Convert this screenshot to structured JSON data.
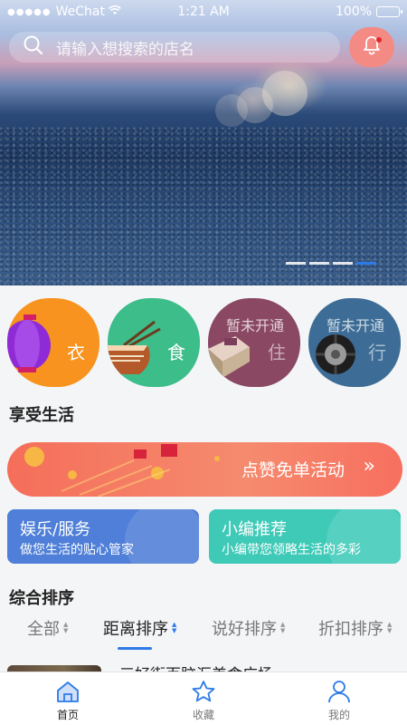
{
  "status_bar": {
    "carrier": "WeChat",
    "time": "1:21 AM",
    "battery": "100%"
  },
  "search": {
    "placeholder": "请输入想搜索的店名"
  },
  "carousel": {
    "page_count": 4,
    "active_index": 3
  },
  "categories": [
    {
      "label": "衣",
      "note": "",
      "color": "#f7931e",
      "enabled": true
    },
    {
      "label": "食",
      "note": "",
      "color": "#3dbd8a",
      "enabled": true
    },
    {
      "label": "住",
      "note": "暂未开通",
      "color": "#8a4862",
      "enabled": false
    },
    {
      "label": "行",
      "note": "暂未开通",
      "color": "#3d6d96",
      "enabled": false
    }
  ],
  "section_life": {
    "title": "享受生活"
  },
  "promo_banner": {
    "text": "点赞免单活动",
    "chevron": "»"
  },
  "cards": [
    {
      "title": "娱乐/服务",
      "subtitle": "做您生活的贴心管家",
      "color": "#4f7fd8"
    },
    {
      "title": "小编推荐",
      "subtitle": "小编带您领略生活的多彩",
      "color": "#3fcab8"
    }
  ],
  "section_rank": {
    "title": "综合排序"
  },
  "sort_tabs": [
    {
      "label": "全部",
      "active": false
    },
    {
      "label": "距离排序",
      "active": true
    },
    {
      "label": "说好排序",
      "active": false
    },
    {
      "label": "折扣排序",
      "active": false
    }
  ],
  "list_peek": {
    "title": "三好街百脑汇美食广场"
  },
  "tab_bar": [
    {
      "label": "首页",
      "icon": "home-icon",
      "active": true
    },
    {
      "label": "收藏",
      "icon": "star-icon",
      "active": false
    },
    {
      "label": "我的",
      "icon": "user-icon",
      "active": false
    }
  ],
  "colors": {
    "accent": "#2d7ae8",
    "bell_bg": "#f38b84",
    "banner": "#f56e5a"
  }
}
